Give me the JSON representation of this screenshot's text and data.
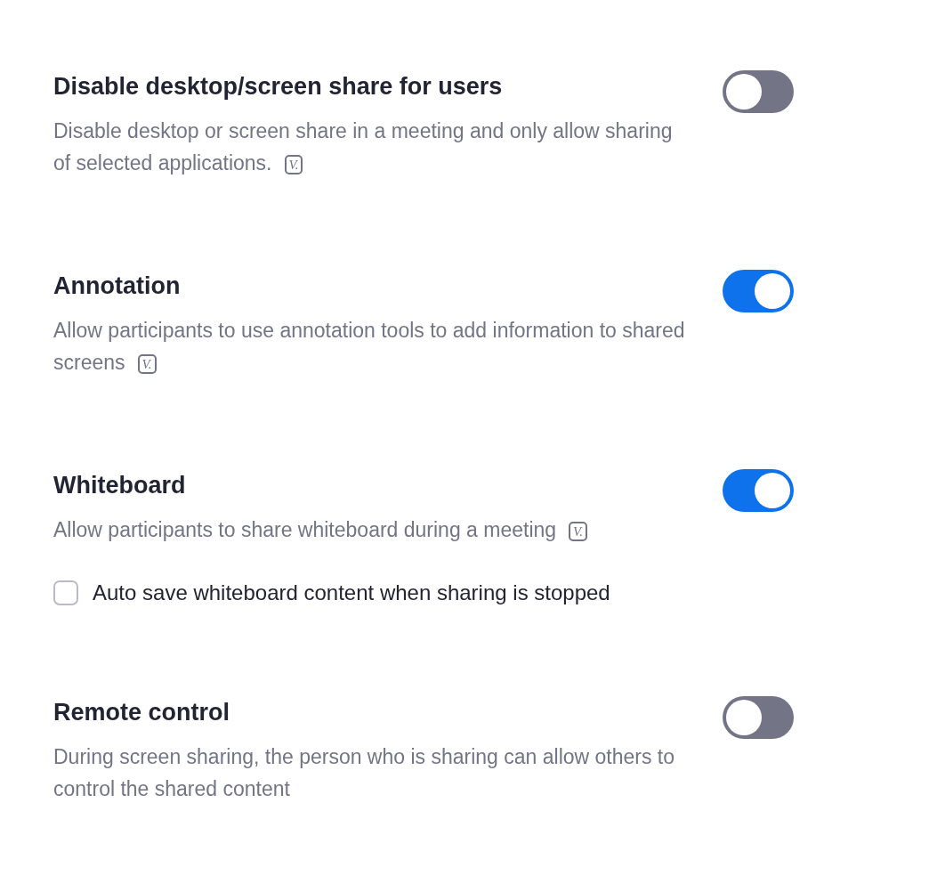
{
  "settings": [
    {
      "title": "Disable desktop/screen share for users",
      "description": "Disable desktop or screen share in a meeting and only allow sharing of selected applications.",
      "version_badge": "V.",
      "on": false
    },
    {
      "title": "Annotation",
      "description": "Allow participants to use annotation tools to add information to shared screens",
      "version_badge": "V.",
      "on": true
    },
    {
      "title": "Whiteboard",
      "description": "Allow participants to share whiteboard during a meeting",
      "version_badge": "V.",
      "on": true,
      "option": {
        "label": "Auto save whiteboard content when sharing is stopped",
        "checked": false
      }
    },
    {
      "title": "Remote control",
      "description": "During screen sharing, the person who is sharing can allow others to control the shared content",
      "on": false
    }
  ]
}
